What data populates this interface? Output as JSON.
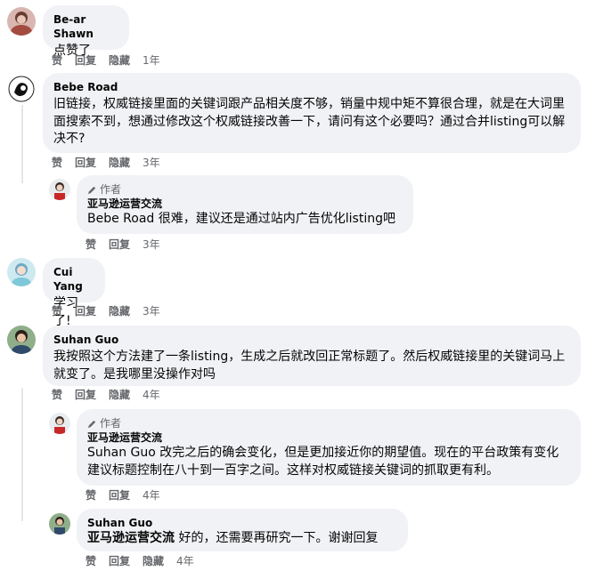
{
  "comments": [
    {
      "name": "Be-ar Shawn",
      "text": "点赞了",
      "actions": {
        "like": "赞",
        "reply": "回复",
        "hide": "隐藏",
        "time": "1年"
      }
    },
    {
      "name": "Bebe Road",
      "text": "旧链接，权威链接里面的关键词跟产品相关度不够，销量中规中矩不算很合理，就是在大词里面搜索不到，想通过修改这个权威链接改善一下，请问有这个必要吗？通过合并listing可以解决不?",
      "actions": {
        "like": "赞",
        "reply": "回复",
        "hide": "隐藏",
        "time": "3年"
      },
      "reply": {
        "tag": "作者",
        "name": "亚马逊运营交流",
        "mention": "Bebe Road",
        "text": " 很难，建议还是通过站内广告优化listing吧",
        "actions": {
          "like": "赞",
          "reply": "回复",
          "time": "3年"
        }
      }
    },
    {
      "name": "Cui Yang",
      "text": "学习了!",
      "actions": {
        "like": "赞",
        "reply": "回复",
        "hide": "隐藏",
        "time": "3年"
      }
    },
    {
      "name": "Suhan Guo",
      "text": "我按照这个方法建了一条listing，生成之后就改回正常标题了。然后权威链接里的关键词马上就变了。是我哪里没操作对吗",
      "actions": {
        "like": "赞",
        "reply": "回复",
        "hide": "隐藏",
        "time": "4年"
      },
      "reply": {
        "tag": "作者",
        "name": "亚马逊运营交流",
        "mention": "Suhan Guo",
        "text": " 改完之后的确会变化，但是更加接近你的期望值。现在的平台政策有变化建议标题控制在八十到一百字之间。这样对权威链接关键词的抓取更有利。",
        "actions": {
          "like": "赞",
          "reply": "回复",
          "time": "4年"
        }
      },
      "reply2": {
        "name": "Suhan Guo",
        "mention": "亚马逊运营交流",
        "text": " 好的，还需要再研究一下。谢谢回复",
        "actions": {
          "like": "赞",
          "reply": "回复",
          "hide": "隐藏",
          "time": "4年"
        }
      }
    }
  ]
}
